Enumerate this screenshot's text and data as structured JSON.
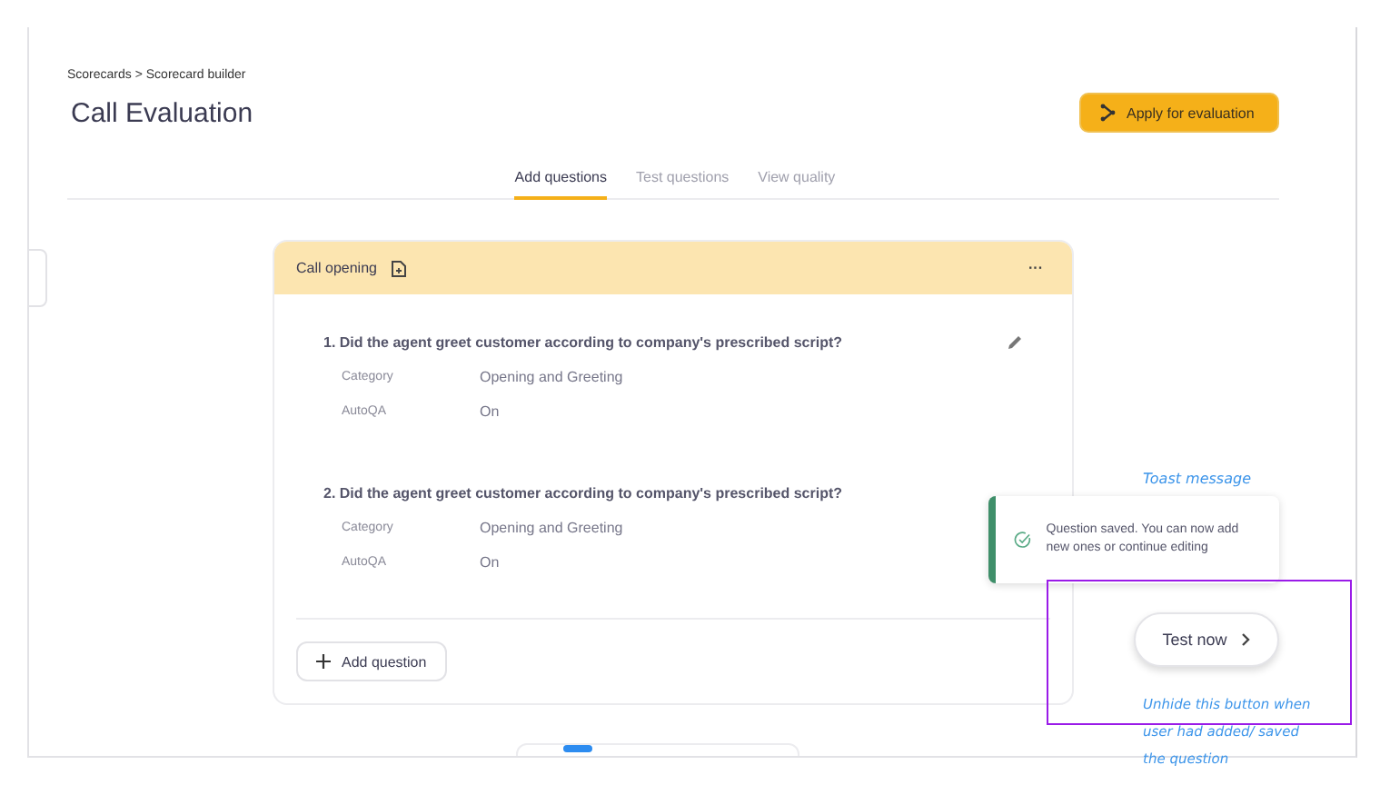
{
  "breadcrumb": "Scorecards > Scorecard builder",
  "title": "Call Evaluation",
  "apply_button": "Apply for evaluation",
  "tabs": [
    {
      "label": "Add questions",
      "selected": true
    },
    {
      "label": "Test questions",
      "selected": false
    },
    {
      "label": "View quality",
      "selected": false
    }
  ],
  "section": {
    "title": "Call opening",
    "menu": "···",
    "questions": [
      {
        "text": "1. Did the agent greet customer according to company's prescribed script?",
        "editable": true,
        "fields": [
          {
            "label": "Category",
            "value": "Opening and Greeting"
          },
          {
            "label": "AutoQA",
            "value": "On"
          }
        ]
      },
      {
        "text": "2. Did the agent greet customer according to company's prescribed script?",
        "editable": false,
        "fields": [
          {
            "label": "Category",
            "value": "Opening and Greeting"
          },
          {
            "label": "AutoQA",
            "value": "On"
          }
        ]
      }
    ],
    "add_button": "Add question"
  },
  "toast": {
    "message": "Question saved. You can now add new ones or continue editing"
  },
  "test_button": "Test now",
  "annotations": [
    {
      "kind": "toast_note",
      "text": "Toast message"
    },
    {
      "kind": "button_note",
      "text": "Unhide this button when user had added/ saved the question"
    }
  ]
}
